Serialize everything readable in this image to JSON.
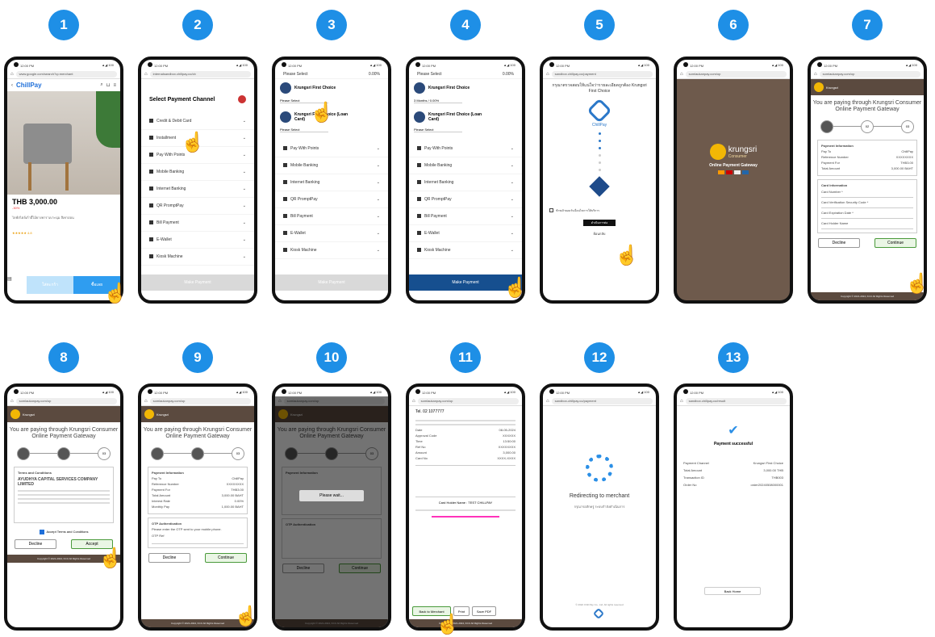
{
  "steps": [
    "1",
    "2",
    "3",
    "4",
    "5",
    "6",
    "7",
    "8",
    "9",
    "10",
    "11",
    "12",
    "13"
  ],
  "p1": {
    "url": "www.google.com/search?q=merchant",
    "brand": "ChillPay",
    "price": "THB 3,000.00",
    "discount": "-30%",
    "desc": "ไลฟ์สไตล์เก้าอี้ไม้ยางพาราเบาะนุ่ม สีเทาอ่อน",
    "rating": "★★★★★ 4.8",
    "btn1": "ใส่ตะกร้า",
    "btn2": "ซื้อเลย"
  },
  "p2": {
    "url": "internalsandbox.chillpay.co/cb",
    "title": "Select Payment Channel",
    "items": [
      "Credit & Debit Card",
      "Installment",
      "Pay With Points",
      "Mobile Banking",
      "Internet Banking",
      "QR PromptPay",
      "Bill Payment",
      "E-Wallet",
      "Kiosk Machine"
    ],
    "btn": "Make Payment"
  },
  "p3": {
    "url": "Please Select",
    "card1": "Krungsri First Choice",
    "card2": "Krungsri First Choice (Loan Card)",
    "select": "Please Select",
    "items": [
      "Pay With Points",
      "Mobile Banking",
      "Internet Banking",
      "QR PromptPay",
      "Bill Payment",
      "E-Wallet",
      "Kiosk Machine"
    ],
    "btn": "Make Payment"
  },
  "p4": {
    "url": "Please Select",
    "card1": "Krungsri First Choice",
    "card2": "Krungsri First Choice (Loan Card)",
    "select1": "3 Months / 0.00%",
    "select2": "Please Select",
    "items": [
      "Pay With Points",
      "Mobile Banking",
      "Internet Banking",
      "QR PromptPay",
      "Bill Payment",
      "E-Wallet",
      "Kiosk Machine"
    ],
    "btn": "Make Payment"
  },
  "p5": {
    "url": "sandbox.chillpay.co/payment",
    "title": "กรุณาตรวจสอบให้แน่ใจว่ารายละเอียดถูกต้อง Krungsri First Choice",
    "logo": "ChillPay",
    "consent": "ข้าพเจ้ายอมรับเงื่อนไขการให้บริการ",
    "btn": "ดำเนินการต่อ",
    "link": "ย้อนกลับ"
  },
  "p6": {
    "url": "somlaukanpay.com/op",
    "brand": "krungsri",
    "sub": "Consumer",
    "gateway": "Online Payment Gateway"
  },
  "k": {
    "url": "somlaukanpay.com/op",
    "brand": "Krungsri",
    "title": "You are paying through Krungsri Consumer Online Payment Gateway",
    "decline": "Decline",
    "continue": "Continue",
    "accept": "Accept",
    "footer": "Copyright © 2021-2024, KCC All Rights Reserved"
  },
  "p7": {
    "payinfo": "Payment Information",
    "rows": [
      [
        "Pay To",
        "ChillPay"
      ],
      [
        "Reference Number",
        "XXXXXXXX"
      ],
      [
        "Payment For",
        "THB3.00"
      ],
      [
        "Total Amount",
        "3,000.00 BAHT"
      ]
    ],
    "cardinfo": "Card Information",
    "fields": [
      "Card Number *",
      "Card Verification Security Code *",
      "Card Expiration Date *",
      "Card Holder Name"
    ]
  },
  "p8": {
    "terms": "Terms and Conditions",
    "company": "AYUDHYA CAPITAL SERVICES COMPANY LIMITED",
    "agree": "Accept Terms and Conditions"
  },
  "p9": {
    "payinfo": "Payment Information",
    "rows": [
      [
        "Pay To",
        "ChillPay"
      ],
      [
        "Reference Number",
        "XXXXXXXX"
      ],
      [
        "Payment For",
        "THB3.00"
      ],
      [
        "Total Amount",
        "3,000.00 BAHT"
      ],
      [
        "Interest Rate",
        "0.00%"
      ],
      [
        "Monthly Pay",
        "1,000.00 BAHT"
      ]
    ],
    "otp": "OTP Authentication",
    "otpmsg": "Please enter the OTP sent to your mobile phone.",
    "otpref": "OTP Ref"
  },
  "p10": {
    "wait": "Please wait..."
  },
  "p11": {
    "hdr": "Tel. 02 1077777",
    "rows": [
      [
        "Date",
        "08-05-2024"
      ],
      [
        "Approval Code",
        "XXXXXX"
      ],
      [
        "Time",
        "13:50:00"
      ],
      [
        "Ref No",
        "XXXXXXXX"
      ],
      [
        "Amount",
        "3,000.00"
      ],
      [
        "Card No",
        "XXXX-XXXX"
      ]
    ],
    "thanks": "Card Holder Name : TEST CHILLPAY",
    "b1": "Back to Merchant",
    "b2": "Print",
    "b3": "Save PDF"
  },
  "p12": {
    "url": "sandbox-chillpay.co/payment",
    "msg": "Redirecting to merchant",
    "sub": "กรุณารอสักครู่ ระบบกำลังดำเนินการ",
    "copy": "© 2022 Chill Pay Co., Ltd. All rights reserved"
  },
  "p13": {
    "url": "sandbox.chillpay.co/result",
    "title": "Payment successful",
    "rows": [
      [
        "Payment Channel",
        "Krungsri First Choice"
      ],
      [
        "Total Amount",
        "3,000.00 THB"
      ],
      [
        "Transaction ID",
        "THB003"
      ],
      [
        "Order No",
        "order20240508000001"
      ]
    ],
    "btn": "Back Home"
  }
}
